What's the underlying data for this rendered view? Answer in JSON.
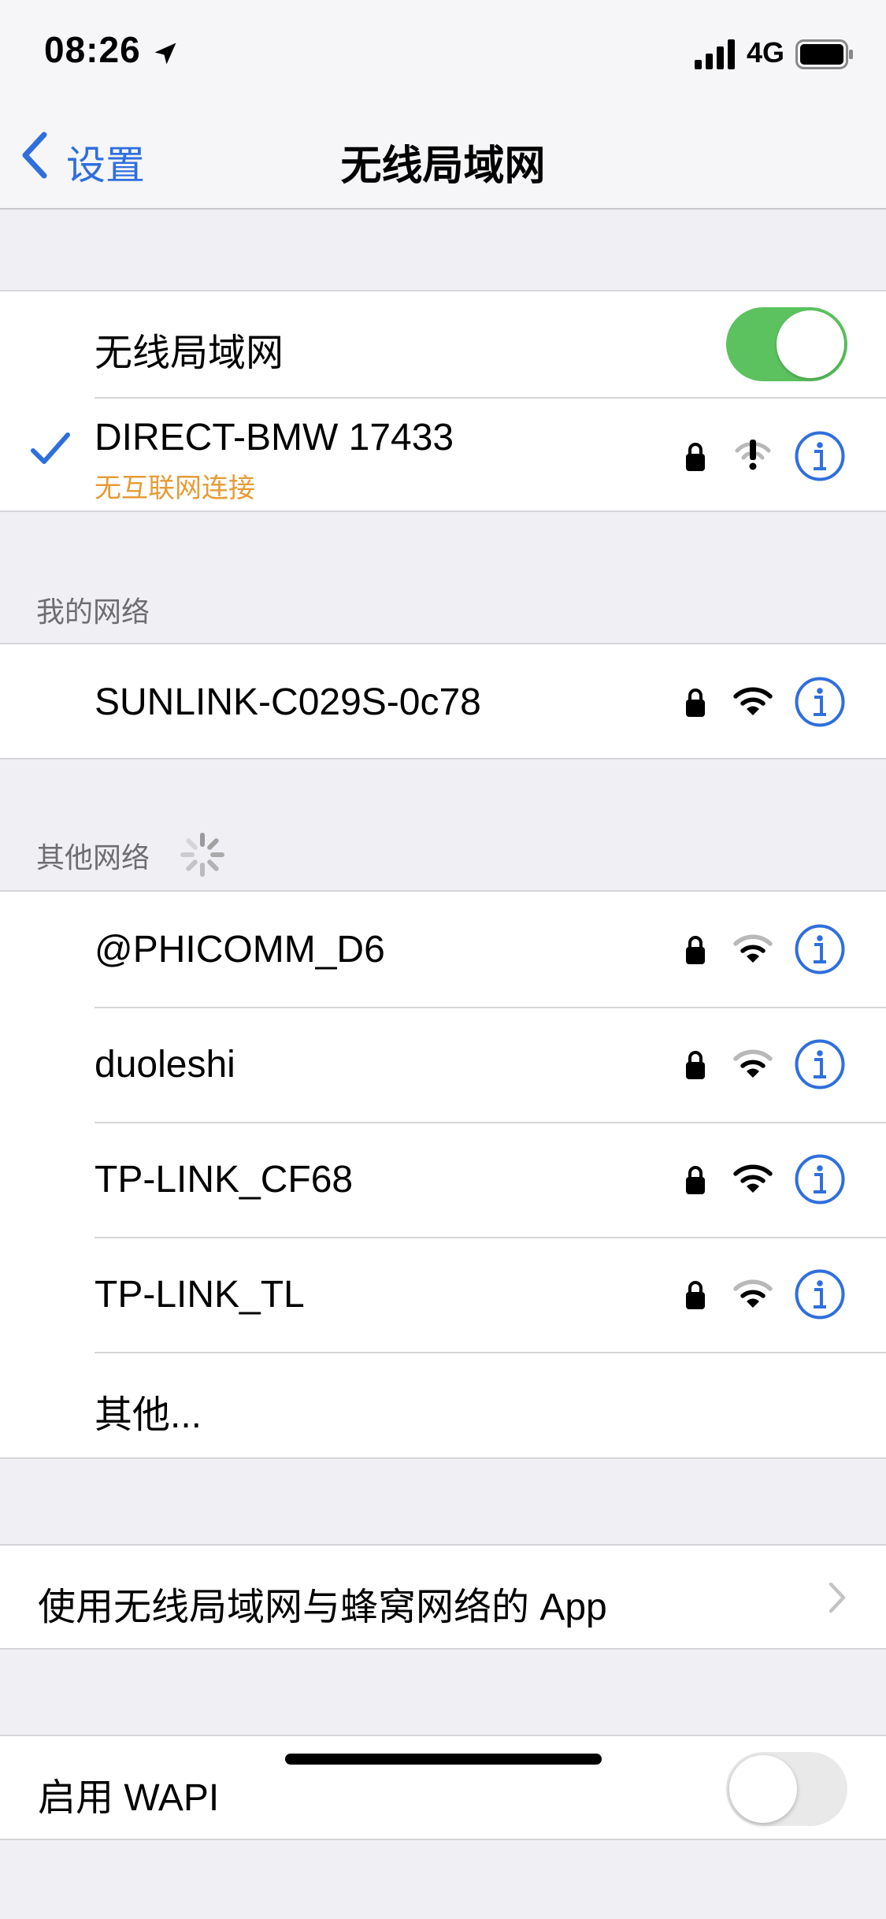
{
  "status_bar": {
    "time": "08:26",
    "network": "4G"
  },
  "nav": {
    "back_label": "设置",
    "title": "无线局域网"
  },
  "wifi_toggle": {
    "label": "无线局域网",
    "on": true
  },
  "current_network": {
    "name": "DIRECT-BMW 17433",
    "status": "无互联网连接"
  },
  "my_networks": {
    "header": "我的网络",
    "items": [
      {
        "name": "SUNLINK-C029S-0c78"
      }
    ]
  },
  "other_networks": {
    "header": "其他网络",
    "items": [
      {
        "name": "@PHICOMM_D6"
      },
      {
        "name": "duoleshi"
      },
      {
        "name": "TP-LINK_CF68"
      },
      {
        "name": "TP-LINK_TL"
      }
    ],
    "other_label": "其他..."
  },
  "apps_row": {
    "label": "使用无线局域网与蜂窝网络的 App"
  },
  "wapi": {
    "label": "启用 WAPI",
    "on": false
  },
  "colors": {
    "accent": "#2f6fdd",
    "toggle_on": "#5cc25f",
    "warning": "#e69b35",
    "background": "#efeff4"
  }
}
